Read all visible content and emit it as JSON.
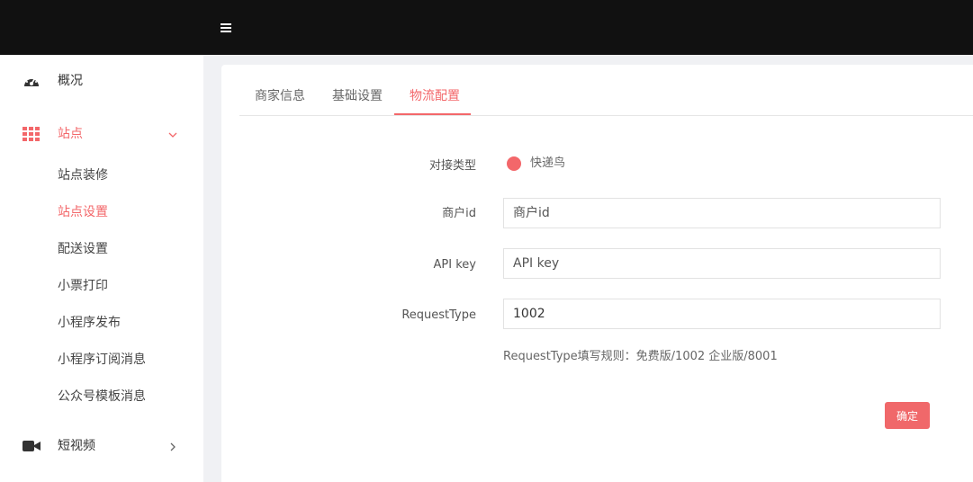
{
  "header": {
    "menu_icon": "hamburger-icon"
  },
  "sidebar": {
    "items": [
      {
        "label": "概况",
        "icon": "dashboard-icon"
      },
      {
        "label": "站点",
        "icon": "grid-icon",
        "active": true,
        "expanded": true
      },
      {
        "label": "短视频",
        "icon": "video-icon"
      }
    ],
    "sub_items": [
      {
        "label": "站点装修"
      },
      {
        "label": "站点设置",
        "active": true
      },
      {
        "label": "配送设置"
      },
      {
        "label": "小票打印"
      },
      {
        "label": "小程序发布"
      },
      {
        "label": "小程序订阅消息"
      },
      {
        "label": "公众号模板消息"
      }
    ]
  },
  "tabs": [
    {
      "label": "商家信息"
    },
    {
      "label": "基础设置"
    },
    {
      "label": "物流配置",
      "active": true
    }
  ],
  "form": {
    "integration_type": {
      "label": "对接类型",
      "selected": "快递鸟"
    },
    "merchant_id": {
      "label": "商户id",
      "placeholder": "商户id",
      "value": ""
    },
    "api_key": {
      "label": "API key",
      "placeholder": "API key",
      "value": ""
    },
    "request_type": {
      "label": "RequestType",
      "value": "1002"
    },
    "hint": "RequestType填写规则：免费版/1002 企业版/8001",
    "submit_label": "确定"
  },
  "colors": {
    "accent": "#f3676a",
    "topbar": "#111111"
  }
}
